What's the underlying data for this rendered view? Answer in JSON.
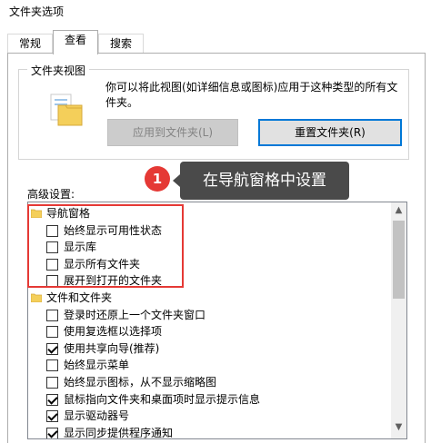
{
  "window": {
    "title": "文件夹选项"
  },
  "tabs": [
    {
      "label": "常规"
    },
    {
      "label": "查看"
    },
    {
      "label": "搜索"
    }
  ],
  "folder_views": {
    "group_label": "文件夹视图",
    "description": "你可以将此视图(如详细信息或图标)应用于这种类型的所有文件夹。",
    "apply_button": "应用到文件夹(L)",
    "reset_button": "重置文件夹(R)"
  },
  "callout": {
    "number": "1",
    "text": "在导航窗格中设置"
  },
  "advanced": {
    "label": "高级设置:",
    "items": [
      {
        "type": "folder",
        "label": "导航窗格",
        "indent": 0
      },
      {
        "type": "checkbox",
        "label": "始终显示可用性状态",
        "checked": false,
        "indent": 1
      },
      {
        "type": "checkbox",
        "label": "显示库",
        "checked": false,
        "indent": 1
      },
      {
        "type": "checkbox",
        "label": "显示所有文件夹",
        "checked": false,
        "indent": 1
      },
      {
        "type": "checkbox",
        "label": "展开到打开的文件夹",
        "checked": false,
        "indent": 1
      },
      {
        "type": "folder",
        "label": "文件和文件夹",
        "indent": 0
      },
      {
        "type": "checkbox",
        "label": "登录时还原上一个文件夹窗口",
        "checked": false,
        "indent": 1
      },
      {
        "type": "checkbox",
        "label": "使用复选框以选择项",
        "checked": false,
        "indent": 1
      },
      {
        "type": "checkbox",
        "label": "使用共享向导(推荐)",
        "checked": true,
        "indent": 1
      },
      {
        "type": "checkbox",
        "label": "始终显示菜单",
        "checked": false,
        "indent": 1
      },
      {
        "type": "checkbox",
        "label": "始终显示图标，从不显示缩略图",
        "checked": false,
        "indent": 1
      },
      {
        "type": "checkbox",
        "label": "鼠标指向文件夹和桌面项时显示提示信息",
        "checked": true,
        "indent": 1
      },
      {
        "type": "checkbox",
        "label": "显示驱动器号",
        "checked": true,
        "indent": 1
      },
      {
        "type": "checkbox",
        "label": "显示同步提供程序通知",
        "checked": true,
        "indent": 1
      }
    ]
  },
  "colors": {
    "accent": "#0078d7",
    "callout_red": "#e53935",
    "callout_bg": "#4a4a4a"
  }
}
